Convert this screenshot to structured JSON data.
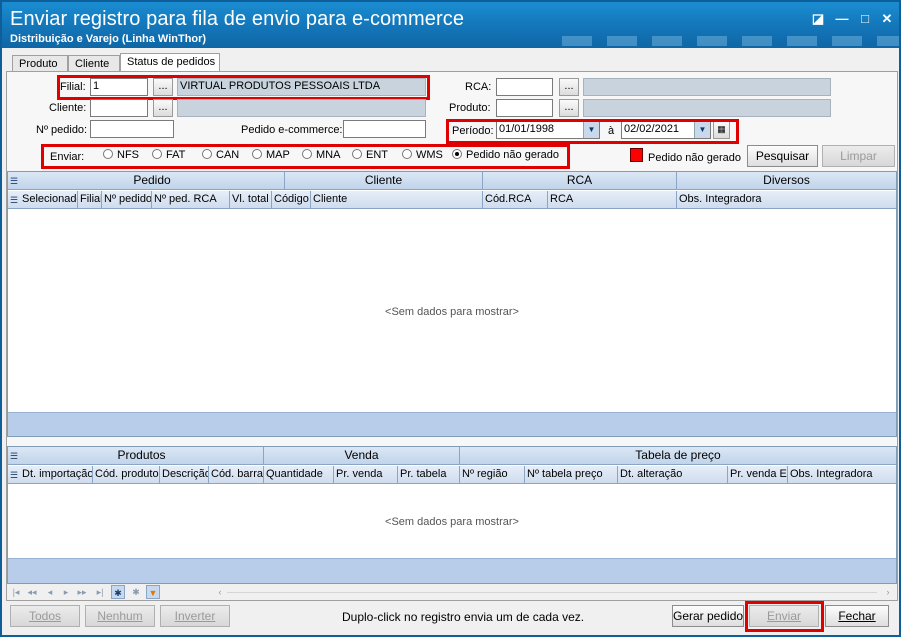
{
  "window": {
    "title": "Enviar registro para fila de envio para e-commerce",
    "subtitle": "Distribuição e Varejo (Linha WinThor)",
    "buttons": {
      "restore": "◪",
      "minimize": "—",
      "maximize": "□",
      "close": "✕"
    }
  },
  "tabs": [
    {
      "label": "Produto"
    },
    {
      "label": "Cliente"
    },
    {
      "label": "Status de pedidos",
      "active": true
    }
  ],
  "filters": {
    "filial": {
      "label": "Filial:",
      "value": "1",
      "name": "VIRTUAL PRODUTOS PESSOAIS LTDA"
    },
    "cliente": {
      "label": "Cliente:",
      "value": "",
      "name": ""
    },
    "nro_pedido": {
      "label": "Nº pedido:",
      "value": ""
    },
    "pedido_ecommerce": {
      "label": "Pedido e-commerce:",
      "value": ""
    },
    "rca": {
      "label": "RCA:",
      "value": "",
      "name": ""
    },
    "produto": {
      "label": "Produto:",
      "value": "",
      "name": ""
    },
    "periodo": {
      "label": "Período:",
      "from": "01/01/1998",
      "sep": "à",
      "to": "02/02/2021"
    },
    "dots": "..."
  },
  "enviar": {
    "label": "Enviar:",
    "options": [
      "NFS",
      "FAT",
      "CAN",
      "MAP",
      "MNA",
      "ENT",
      "WMS",
      "Pedido não gerado"
    ],
    "selected": "Pedido não gerado"
  },
  "legend": {
    "label": "Pedido não gerado",
    "color": "#ff0000"
  },
  "actions": {
    "pesquisar": "Pesquisar",
    "limpar": "Limpar"
  },
  "grid1": {
    "bands": [
      "Pedido",
      "Cliente",
      "RCA",
      "Diversos"
    ],
    "columns": [
      "Selecionado",
      "Filial",
      "Nº pedido",
      "Nº ped. RCA",
      "Vl. total",
      "Código",
      "Cliente",
      "Cód.RCA",
      "RCA",
      "Obs. Integradora"
    ],
    "empty_text": "<Sem dados para mostrar>"
  },
  "grid2": {
    "bands": [
      "Produtos",
      "Venda",
      "Tabela de preço"
    ],
    "columns": [
      "Dt. importação",
      "Cód. produto",
      "Descrição",
      "Cód. barra",
      "Quantidade",
      "Pr. venda",
      "Pr. tabela",
      "Nº região",
      "Nº tabela preço",
      "Dt. alteração",
      "Pr. venda E",
      "Obs. Integradora"
    ],
    "empty_text": "<Sem dados para mostrar>"
  },
  "footer": {
    "todos": "Todos",
    "nenhum": "Nenhum",
    "inverter": "Inverter",
    "hint": "Duplo-click no registro envia um de cada vez.",
    "gerar_pedido": "Gerar pedido",
    "enviar": "Enviar",
    "fechar": "Fechar"
  }
}
